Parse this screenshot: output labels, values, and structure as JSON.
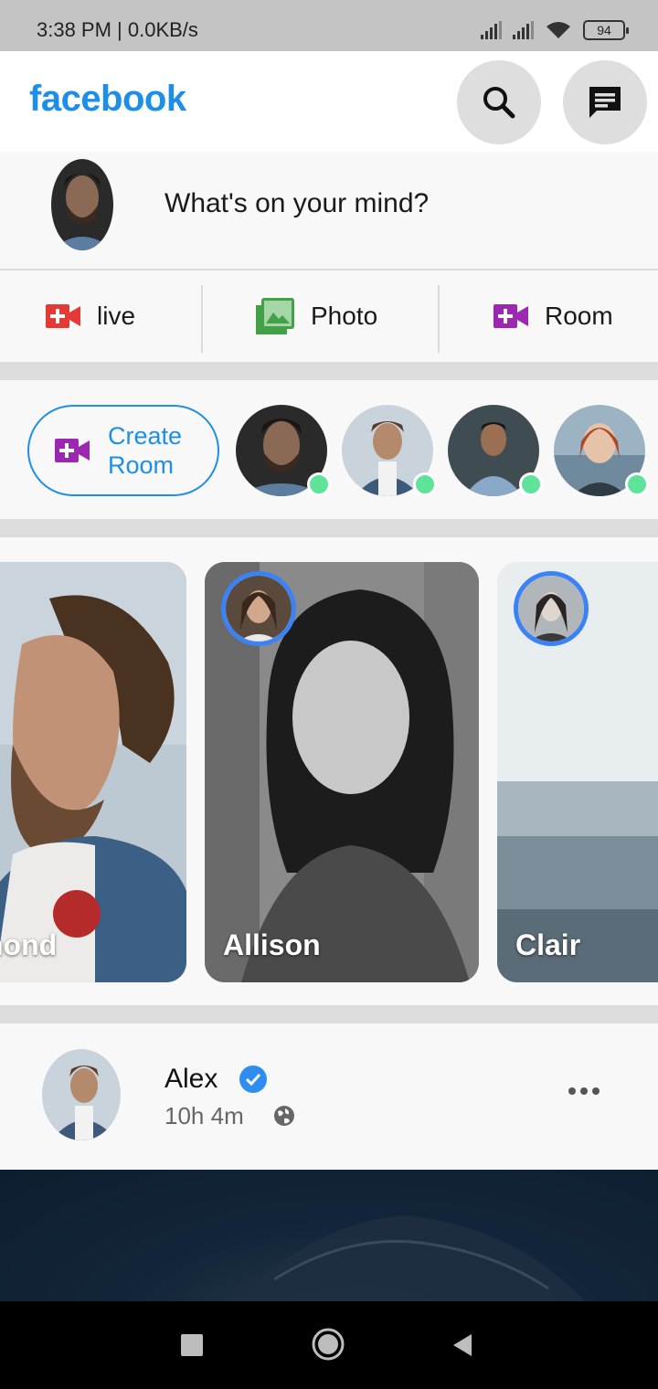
{
  "status_bar": {
    "time": "3:38 PM | 0.0KB/s",
    "battery": "94"
  },
  "header": {
    "logo": "facebook",
    "brand_color": "#1d8fe8",
    "icons": [
      "search-icon",
      "messenger-icon"
    ]
  },
  "composer": {
    "prompt": "What's on your mind?"
  },
  "actions": [
    {
      "label": "live",
      "icon": "video-plus-icon",
      "color": "#e53935"
    },
    {
      "label": "Photo",
      "icon": "photo-gallery-icon",
      "color": "#43a047"
    },
    {
      "label": "Room",
      "icon": "video-plus-icon",
      "color": "#9c27b0"
    }
  ],
  "rooms": {
    "create_label_line1": "Create",
    "create_label_line2": "Room",
    "online_color": "#5fe39a"
  },
  "stories": [
    {
      "name": "hond"
    },
    {
      "name": "Allison"
    },
    {
      "name": "Clair"
    }
  ],
  "post": {
    "author": "Alex",
    "time": "10h 4m",
    "verified_color": "#2e8ef0"
  }
}
